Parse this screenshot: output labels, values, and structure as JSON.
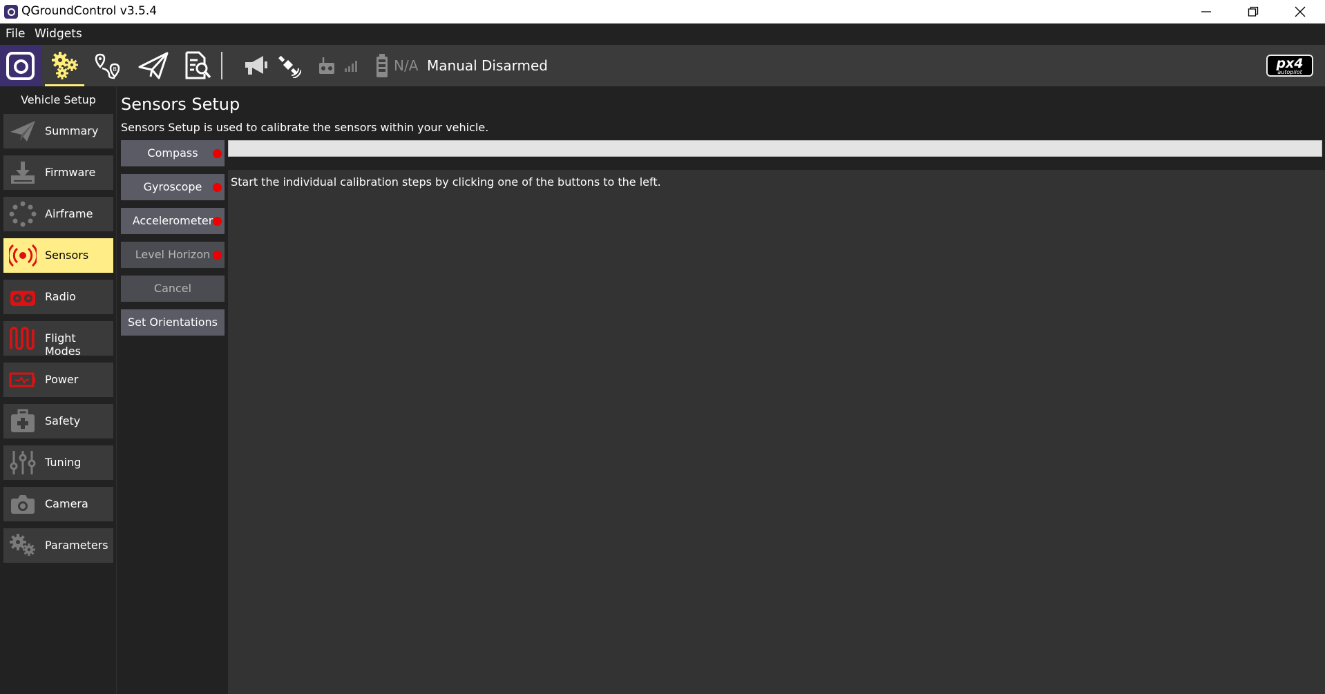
{
  "window": {
    "title": "QGroundControl v3.5.4"
  },
  "menubar": {
    "items": [
      "File",
      "Widgets"
    ]
  },
  "toolbar": {
    "battery_text": "N/A",
    "flight_mode": "Manual",
    "arm_state": "Disarmed",
    "brand_logo": "px4",
    "brand_logo_sub": "autopilot",
    "icons": [
      "qgc-logo-icon",
      "vehicle-setup-gear-icon",
      "plan-view-icon",
      "fly-view-icon",
      "analyze-view-icon",
      "megaphone-icon",
      "satellite-icon",
      "rc-transmitter-icon",
      "signal-strength-icon",
      "battery-icon"
    ],
    "accent_color": "#ffee77"
  },
  "sidebar": {
    "title": "Vehicle Setup",
    "items": [
      {
        "label": "Summary",
        "icon": "paper-plane-icon",
        "active": false
      },
      {
        "label": "Firmware",
        "icon": "download-icon",
        "active": false
      },
      {
        "label": "Airframe",
        "icon": "airframe-dots-icon",
        "active": false
      },
      {
        "label": "Sensors",
        "icon": "sensors-broadcast-icon",
        "active": true
      },
      {
        "label": "Radio",
        "icon": "radio-icon",
        "active": false
      },
      {
        "label": "Flight Modes",
        "icon": "flight-modes-wave-icon",
        "active": false
      },
      {
        "label": "Power",
        "icon": "power-battery-icon",
        "active": false
      },
      {
        "label": "Safety",
        "icon": "safety-medkit-icon",
        "active": false
      },
      {
        "label": "Tuning",
        "icon": "tuning-sliders-icon",
        "active": false
      },
      {
        "label": "Camera",
        "icon": "camera-icon",
        "active": false
      },
      {
        "label": "Parameters",
        "icon": "parameters-gears-icon",
        "active": false
      }
    ]
  },
  "main": {
    "title": "Sensors Setup",
    "description": "Sensors Setup is used to calibrate the sensors within your vehicle.",
    "buttons": [
      {
        "label": "Compass",
        "status": "not-calibrated",
        "enabled": true
      },
      {
        "label": "Gyroscope",
        "status": "not-calibrated",
        "enabled": true
      },
      {
        "label": "Accelerometer",
        "status": "not-calibrated",
        "enabled": true
      },
      {
        "label": "Level Horizon",
        "status": "not-calibrated",
        "enabled": false
      },
      {
        "label": "Cancel",
        "enabled": false
      },
      {
        "label": "Set Orientations",
        "enabled": true
      }
    ],
    "progress": 0,
    "instructions": "Start the individual calibration steps by clicking one of the buttons to the left.",
    "status_dot_color": "#ee0000"
  }
}
